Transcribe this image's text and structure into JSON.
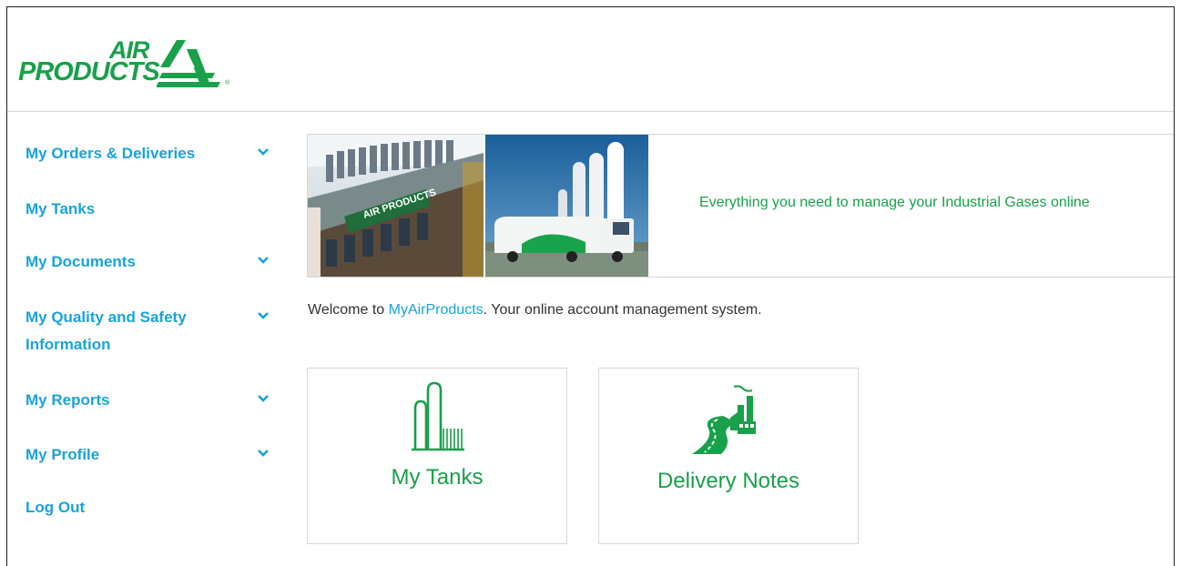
{
  "logo": {
    "line1": "AIR",
    "line2": "PRODUCTS",
    "mark": "®"
  },
  "colors": {
    "brand_green": "#19a04a",
    "link_blue": "#1aa3d9",
    "border": "#d6d6d6"
  },
  "sidebar": {
    "items": [
      {
        "label": "My Orders & Deliveries",
        "expandable": true,
        "icon": "chevron-down-icon"
      },
      {
        "label": "My Tanks",
        "expandable": false
      },
      {
        "label": "My Documents",
        "expandable": true,
        "icon": "chevron-down-icon"
      },
      {
        "label": "My Quality and Safety Information",
        "expandable": true,
        "icon": "chevron-down-icon"
      },
      {
        "label": "My Reports",
        "expandable": true,
        "icon": "chevron-down-icon"
      },
      {
        "label": "My Profile",
        "expandable": true,
        "icon": "chevron-down-icon"
      },
      {
        "label": "Log Out",
        "expandable": false
      }
    ]
  },
  "banner": {
    "tagline": "Everything you need to manage your Industrial Gases online",
    "photo_text": "AIR PRODUCTS"
  },
  "welcome": {
    "prefix": "Welcome to ",
    "brand": "MyAirProducts",
    "suffix": ". Your online account management system."
  },
  "tiles": [
    {
      "label": "My Tanks",
      "icon": "storage-tanks-icon"
    },
    {
      "label": "Delivery Notes",
      "icon": "delivery-road-factory-icon"
    }
  ]
}
